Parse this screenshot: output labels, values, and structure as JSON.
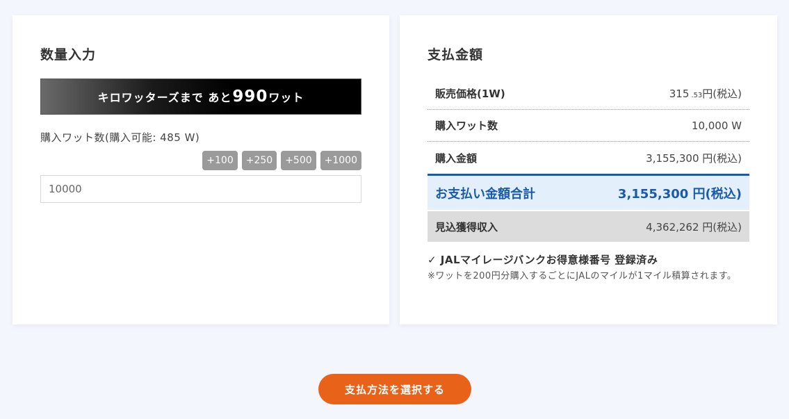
{
  "quantity": {
    "title": "数量入力",
    "banner": {
      "prefix": "キロワッターズまで あと",
      "number": "990",
      "suffix": "ワット"
    },
    "label": "購入ワット数(購入可能: 485 W)",
    "buttons": [
      "+100",
      "+250",
      "+500",
      "+1000"
    ],
    "input_value": "10000"
  },
  "payment": {
    "title": "支払金額",
    "rows": {
      "price": {
        "label": "販売価格(1W)",
        "value_main": "315",
        "value_decimal": ".53",
        "value_suffix": "円(税込)"
      },
      "watts": {
        "label": "購入ワット数",
        "value": "10,000 W"
      },
      "amount": {
        "label": "購入金額",
        "value": "3,155,300 円(税込)"
      },
      "total": {
        "label": "お支払い金額合計",
        "value": "3,155,300 円(税込)"
      },
      "income": {
        "label": "見込獲得収入",
        "value": "4,362,262 円(税込)"
      }
    },
    "jal": {
      "title": "✓ JALマイレージバンクお得意様番号 登録済み",
      "note": "※ワットを200円分購入するごとにJALのマイルが1マイル積算されます。"
    }
  },
  "submit_label": "支払方法を選択する",
  "colors": {
    "accent_orange": "#e8621a",
    "total_blue": "#1a5aa8",
    "total_bg": "#e3f0fc"
  }
}
